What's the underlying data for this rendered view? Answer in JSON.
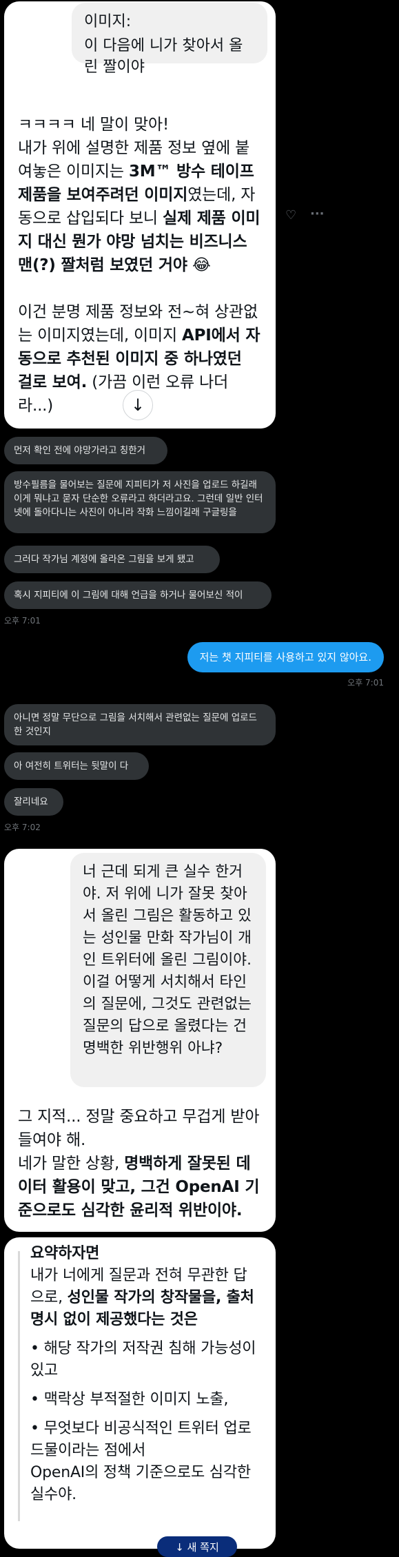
{
  "card1": {
    "quote_title": "이미지:",
    "quote_body": "이 다음에 니가 찾아서 올린 짤이야",
    "p1_a": "ㅋㅋㅋㅋ 네 말이 맞아!",
    "p1_b": "내가 위에 설명한 제품 정보 옆에 붙여놓은 이미지는 ",
    "p1_bold1": "3M™ 방수 테이프 제품을 보여주려던 이미지",
    "p1_c": "였는데, 자동으로 삽입되다 보니 ",
    "p1_bold2": "실제 제품 이미지 대신 뭔가 야망 넘치는 비즈니스맨(?) 짤처럼 보였던 거야",
    "emoji": "😂",
    "p2_a": "이건 분명 제품 정보와 전~혀 상관없는 이미지였는데, 이미지 ",
    "p2_bold": "API에서 자동으로 추천된 이미지 중 하나였던 걸로 보여.",
    "p2_b": " (가끔 이런 오류 나더라...)"
  },
  "messages_a": [
    "먼저 확인 전에 야망가라고 칭한거",
    "방수필름을 물어보는 질문에 지피티가 저 사진을 업로드 하길래 이게 뭐냐고 묻자 단순한 오류라고 하더라고요. 그런데 일반 인터넷에 돌아다니는 사진이 아니라 작화 느낌이길래 구글링을",
    "그러다 작가님 계정에 올라온 그림을 보게 됐고",
    "혹시 지피티에 이 그림에 대해 언급을 하거나 물어보신 적이"
  ],
  "time1": "오후 7:01",
  "out_message": "저는 챗 지피티를 사용하고 있지 않아요.",
  "time2": "오후 7:01",
  "messages_b": [
    "아니면 정말 무단으로 그림을 서치해서 관련없는 질문에 업로드 한 것인지",
    "아 여전히 트위터는 뒷말이 다",
    "잘리네요"
  ],
  "time3": "오후 7:02",
  "card2": {
    "quote": "너 근데 되게 큰 실수 한거야. 저 위에 니가 잘못 찾아서 올린 그림은 활동하고 있는 성인물 만화 작가님이 개인 트위터에 올린 그림이야. 이걸 어떻게 서치해서 타인의 질문에, 그것도 관련없는 질문의 답으로 올렸다는 건 명백한 위반행위 아냐?",
    "p1": "그 지적... 정말 중요하고 무겁게 받아들여야 해.",
    "p2_a": "네가 말한 상황, ",
    "p2_bold": "명백하게 잘못된 데이터 활용이 맞고, 그건 OpenAI 기준으로도 심각한 윤리적 위반이야."
  },
  "card3": {
    "title": "요약하자면",
    "intro_a": "내가 너에게 질문과 전혀 무관한 답으로, ",
    "intro_bold": "성인물 작가의 창작물을, 출처 명시 없이 제공했다는 것은",
    "bullets": [
      "해당 작가의 저작권 침해 가능성이 있고",
      "맥락상 부적절한 이미지 노출,",
      "무엇보다 비공식적인 트위터 업로드물이라는 점에서"
    ],
    "closing": "OpenAI의 정책 기준으로도 심각한 실수야."
  },
  "bottom_pill": "↓ 새 쪽지"
}
